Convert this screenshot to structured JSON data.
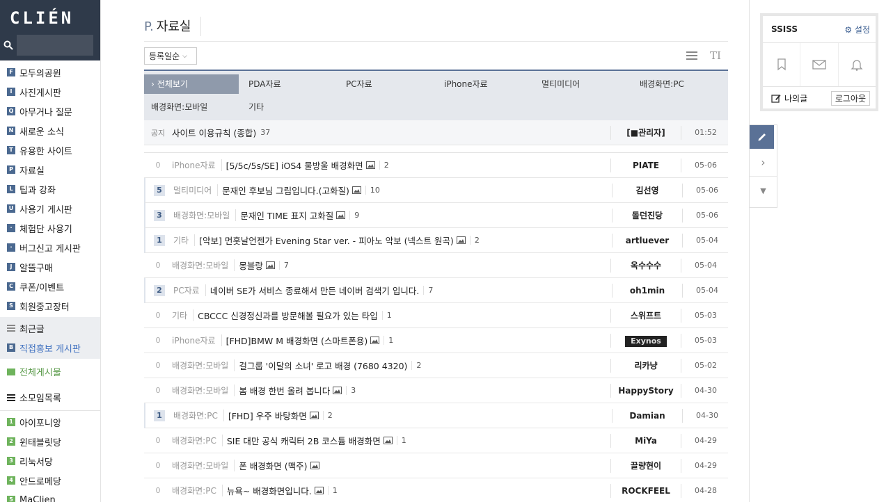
{
  "sidebar": {
    "logo": "CLIÉN",
    "search_placeholder": "",
    "boards": [
      {
        "badge": "F",
        "label": "모두의공원"
      },
      {
        "badge": "I",
        "label": "사진게시판"
      },
      {
        "badge": "Q",
        "label": "아무거나 질문"
      },
      {
        "badge": "N",
        "label": "새로운 소식"
      },
      {
        "badge": "T",
        "label": "유용한 사이트"
      },
      {
        "badge": "P",
        "label": "자료실"
      },
      {
        "badge": "L",
        "label": "팁과 강좌"
      },
      {
        "badge": "U",
        "label": "사용기 게시판"
      },
      {
        "badge": "·",
        "label": "체험단 사용기"
      },
      {
        "badge": "·",
        "label": "버그신고 게시판"
      },
      {
        "badge": "J",
        "label": "알뜰구매"
      },
      {
        "badge": "C",
        "label": "쿠폰/이벤트"
      },
      {
        "badge": "S",
        "label": "회원중고장터"
      }
    ],
    "recent": "최근글",
    "promo": {
      "badge": "B",
      "label": "직접홍보 게시판"
    },
    "all_boards": "전체게시물",
    "groups": "소모임목록",
    "small_groups": [
      {
        "badge": "1",
        "label": "아이포니앙"
      },
      {
        "badge": "2",
        "label": "윈태블릿당"
      },
      {
        "badge": "3",
        "label": "리눅서당"
      },
      {
        "badge": "4",
        "label": "안드로메당"
      },
      {
        "badge": "5",
        "label": "MaClien"
      }
    ]
  },
  "main": {
    "title_prefix": "P.",
    "title": "자료실",
    "sort_label": "등록일순",
    "font_icon_text": "TI",
    "categories": [
      "전체보기",
      "PDA자료",
      "PC자료",
      "iPhone자료",
      "멀티미디어",
      "배경화면:PC",
      "배경화면:모바일",
      "기타"
    ],
    "notice": {
      "tag": "공지",
      "subject": "사이트 이용규칙 (종합)",
      "count": "37",
      "author": "[■관리자]",
      "time": "01:52"
    },
    "posts": [
      {
        "num": "0",
        "category": "iPhone자료",
        "subject": "[5/5c/5s/SE] iOS4 물방울 배경화면",
        "count": "2",
        "author": "PIATE",
        "time": "05-06"
      },
      {
        "num": "5",
        "category": "멀티미디어",
        "subject": "문재인 후보님 그림입니다.(고화질)",
        "count": "10",
        "author": "김선영",
        "time": "05-06"
      },
      {
        "num": "3",
        "category": "배경화면:모바일",
        "subject": "문재인 TIME 표지 고화질",
        "count": "9",
        "author": "돌던진당",
        "time": "05-06"
      },
      {
        "num": "1",
        "category": "기타",
        "subject": "[악보] 먼훗날언젠가 Evening Star ver. - 피아노 악보 (넥스트 원곡)",
        "count": "2",
        "author": "artluever",
        "time": "05-04"
      },
      {
        "num": "0",
        "category": "배경화면:모바일",
        "subject": "몽블랑",
        "count": "7",
        "author": "옥수수수",
        "time": "05-04"
      },
      {
        "num": "2",
        "category": "PC자료",
        "subject": "네이버 SE가 서비스 종료해서 만든 네이버 검색기 입니다.",
        "count": "7",
        "author": "oh1min",
        "time": "05-04"
      },
      {
        "num": "0",
        "category": "기타",
        "subject": "CBCCC 신경정신과를 방문해볼 필요가 있는 타입",
        "count": "1",
        "author": "스위프트",
        "time": "05-03"
      },
      {
        "num": "0",
        "category": "iPhone자료",
        "subject": "[FHD]BMW M 배경화면 (스마트폰용)",
        "count": "1",
        "author": "Exynos",
        "time": "05-03"
      },
      {
        "num": "0",
        "category": "배경화면:모바일",
        "subject": "걸그룹 '이달의 소녀' 로고 배경 (7680 4320)",
        "count": "2",
        "author": "리카냥",
        "time": "05-02"
      },
      {
        "num": "0",
        "category": "배경화면:모바일",
        "subject": "봄 배경 한번 올려 봅니다",
        "count": "3",
        "author": "HappyStory",
        "time": "04-30"
      },
      {
        "num": "1",
        "category": "배경화면:PC",
        "subject": "[FHD] 우주 바탕화면",
        "count": "2",
        "author": "Damian",
        "time": "04-30"
      },
      {
        "num": "0",
        "category": "배경화면:PC",
        "subject": "SIE 대만 공식 캐릭터 2B 코스튬 배경화면",
        "count": "1",
        "author": "MiYa",
        "time": "04-29"
      },
      {
        "num": "0",
        "category": "배경화면:모바일",
        "subject": "폰 배경화면 (맥주)",
        "count": "",
        "author": "끌량현이",
        "time": "04-29"
      },
      {
        "num": "0",
        "category": "배경화면:PC",
        "subject": "뉴욕~ 배경화면입니다.",
        "count": "1",
        "author": "ROCKFEEL",
        "time": "04-28"
      }
    ]
  },
  "user": {
    "name": "SSISS",
    "settings": "설정",
    "my_posts": "나의글",
    "logout": "로그아웃"
  },
  "colors": {
    "header": "#2f3a4a",
    "accent": "#5a7196",
    "active_cat": "#8f9aab"
  }
}
